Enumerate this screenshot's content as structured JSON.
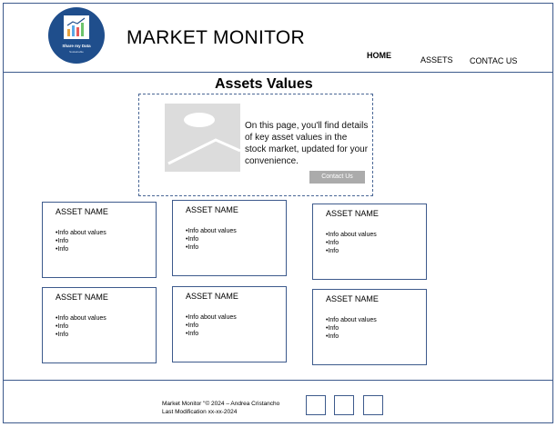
{
  "header": {
    "logo": {
      "name": "Share my Data",
      "tagline": "Sustainable"
    },
    "title": "MARKET MONITOR",
    "nav": {
      "home": "HOME",
      "assets": "ASSETS",
      "contact": "CONTAC US"
    }
  },
  "main": {
    "title": "Assets Values",
    "hero": {
      "image_icon": "image-placeholder-icon",
      "text": "On this page, you'll find details of key asset values in the stock market, updated for your convenience.",
      "button": "Contact Us"
    },
    "cards": [
      {
        "title": "ASSET NAME",
        "lines": [
          "•Info about values",
          "•Info",
          "•Info"
        ]
      },
      {
        "title": "ASSET NAME",
        "lines": [
          "•Info about values",
          "•Info",
          "•Info"
        ]
      },
      {
        "title": "ASSET NAME",
        "lines": [
          "•Info about values",
          "•Info",
          "•Info"
        ]
      },
      {
        "title": "ASSET NAME",
        "lines": [
          "•Info about values",
          "•Info",
          "•Info"
        ]
      },
      {
        "title": "ASSET NAME",
        "lines": [
          "•Info about values",
          "•Info",
          "•Info"
        ]
      },
      {
        "title": "ASSET NAME",
        "lines": [
          "•Info about values",
          "•Info",
          "•Info"
        ]
      }
    ]
  },
  "footer": {
    "copyright": "Market Monitor \"© 2024 – Andrea Cristancho",
    "modified": "Last Modification xx-xx-2024",
    "social_links": [
      "social-link-placeholder",
      "social-link-placeholder",
      "social-link-placeholder"
    ]
  },
  "colors": {
    "border": "#3d5a8c",
    "logo": "#1f4e8c",
    "button": "#ababab",
    "placeholder": "#dcdcdc"
  }
}
